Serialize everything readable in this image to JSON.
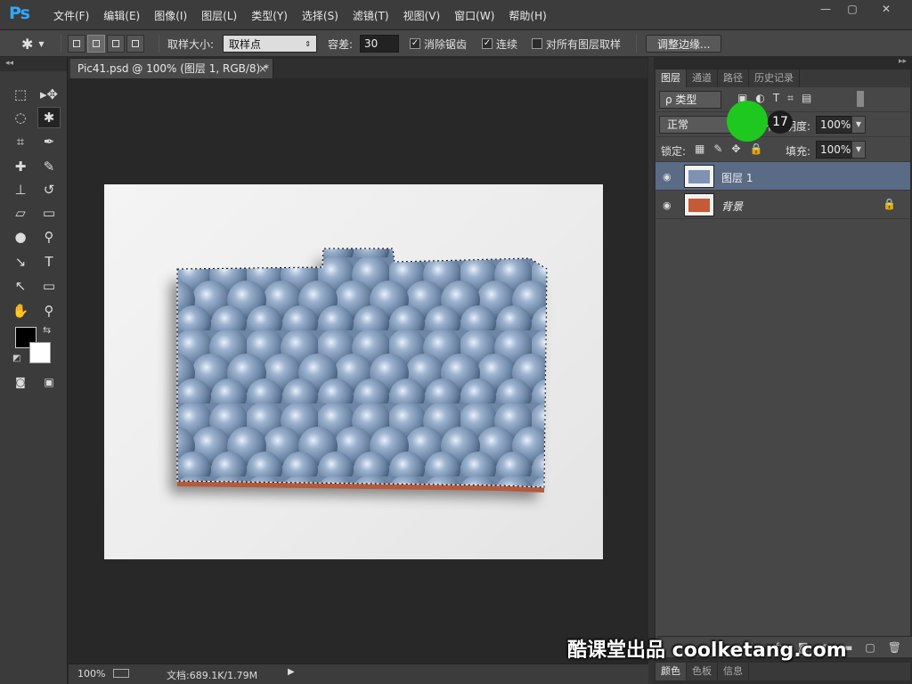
{
  "app": {
    "logo": "Ps",
    "menu": [
      "文件(F)",
      "编辑(E)",
      "图像(I)",
      "图层(L)",
      "类型(Y)",
      "选择(S)",
      "滤镜(T)",
      "视图(V)",
      "窗口(W)",
      "帮助(H)"
    ],
    "window_controls": [
      "—",
      "▢",
      "✕"
    ]
  },
  "options": {
    "sample_size_label": "取样大小:",
    "sample_size_value": "取样点",
    "tolerance_label": "容差:",
    "tolerance_value": "30",
    "anti_alias_label": "消除锯齿",
    "anti_alias_checked": true,
    "contiguous_label": "连续",
    "contiguous_checked": true,
    "sample_all_label": "对所有图层取样",
    "sample_all_checked": false,
    "refine_edge_label": "调整边缘..."
  },
  "toolbox": {
    "tools": [
      "marquee-icon",
      "move-icon",
      "lasso-icon",
      "magic-wand-icon",
      "crop-icon",
      "eyedropper-icon",
      "healing-icon",
      "brush-icon",
      "stamp-icon",
      "history-brush-icon",
      "eraser-icon",
      "gradient-icon",
      "blur-icon",
      "dodge-icon",
      "pen-icon",
      "type-icon",
      "path-select-icon",
      "shape-icon",
      "hand-icon",
      "zoom-icon"
    ],
    "active_tool": "magic-wand-icon",
    "foreground_color": "#000000",
    "background_color": "#ffffff"
  },
  "document": {
    "tab_title": "Pic41.psd @ 100% (图层 1, RGB/8) *",
    "tab_close": "×"
  },
  "status": {
    "zoom": "100%",
    "doc_info": "文档:689.1K/1.79M",
    "arrow": "▶"
  },
  "layers_panel": {
    "tabs": [
      "图层",
      "通道",
      "路径",
      "历史记录"
    ],
    "active_tab": "图层",
    "filter_label": "ρ 类型",
    "blend_mode": "正常",
    "opacity_label": "不透明度:",
    "opacity_value": "100%",
    "lock_label": "锁定:",
    "fill_label": "填充:",
    "fill_value": "100%",
    "layers": [
      {
        "name": "图层 1",
        "selected": true,
        "locked": false
      },
      {
        "name": "背景",
        "selected": false,
        "locked": true
      }
    ],
    "footer_icons": [
      "link-icon",
      "fx-icon",
      "mask-icon",
      "adjustment-icon",
      "folder-icon",
      "new-layer-icon",
      "trash-icon"
    ]
  },
  "bottom_tabs": [
    "颜色",
    "色板",
    "信息"
  ],
  "overlay": {
    "click_badge": "17",
    "watermark": "酷课堂出品 coolketang.com"
  }
}
